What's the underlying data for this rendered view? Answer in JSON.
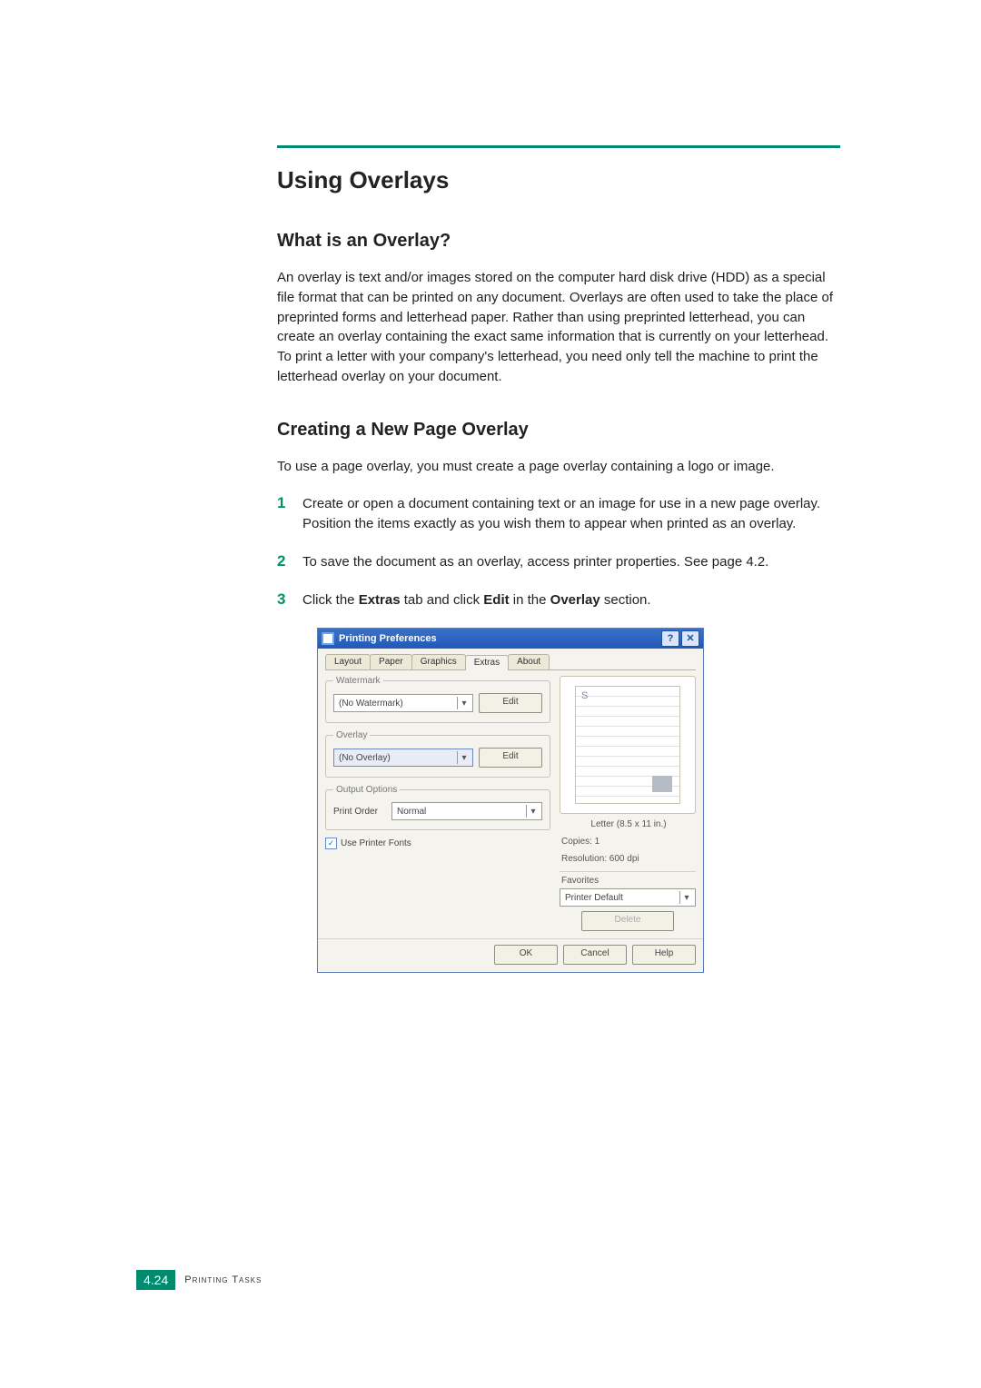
{
  "headings": {
    "h1": "Using Overlays",
    "h2a": "What is an Overlay?",
    "h2b": "Creating a New Page Overlay"
  },
  "paragraphs": {
    "intro": "An overlay is text and/or images stored on the computer hard disk drive (HDD) as a special file format that can be printed on any document. Overlays are often used to take the place of preprinted forms and letterhead paper. Rather than using preprinted letterhead, you can create an overlay containing the exact same information that is currently on your letterhead. To print a letter with your company's letterhead, you need only tell the machine to print the letterhead overlay on your document.",
    "lead": "To use a page overlay, you must create a page overlay containing a logo or image."
  },
  "steps": {
    "s1": "Create or open a document containing text or an image for use in a new page overlay. Position the items exactly as you wish them to appear when printed as an overlay.",
    "s2": "To save the document as an overlay, access printer properties. See page 4.2.",
    "s3_pre": "Click the ",
    "s3_b1": "Extras",
    "s3_mid1": " tab and click ",
    "s3_b2": "Edit",
    "s3_mid2": " in the ",
    "s3_b3": "Overlay",
    "s3_post": " section.",
    "n1": "1",
    "n2": "2",
    "n3": "3"
  },
  "dialog": {
    "title": "Printing Preferences",
    "help_btn": "?",
    "close_btn": "✕",
    "tabs": {
      "layout": "Layout",
      "paper": "Paper",
      "graphics": "Graphics",
      "extras": "Extras",
      "about": "About"
    },
    "watermark": {
      "legend": "Watermark",
      "value": "(No Watermark)",
      "edit": "Edit"
    },
    "overlay": {
      "legend": "Overlay",
      "value": "(No Overlay)",
      "edit": "Edit"
    },
    "output": {
      "legend": "Output Options",
      "print_order_label": "Print Order",
      "print_order_value": "Normal",
      "use_printer_fonts": "Use Printer Fonts"
    },
    "right": {
      "paper_size": "Letter (8.5 x 11 in.)",
      "copies": "Copies: 1",
      "resolution": "Resolution: 600 dpi",
      "favorites_label": "Favorites",
      "favorites_value": "Printer Default",
      "delete": "Delete",
      "preview_S": "S"
    },
    "footer": {
      "ok": "OK",
      "cancel": "Cancel",
      "help": "Help"
    }
  },
  "page_footer": {
    "num": "4.24",
    "section": "Printing Tasks"
  }
}
